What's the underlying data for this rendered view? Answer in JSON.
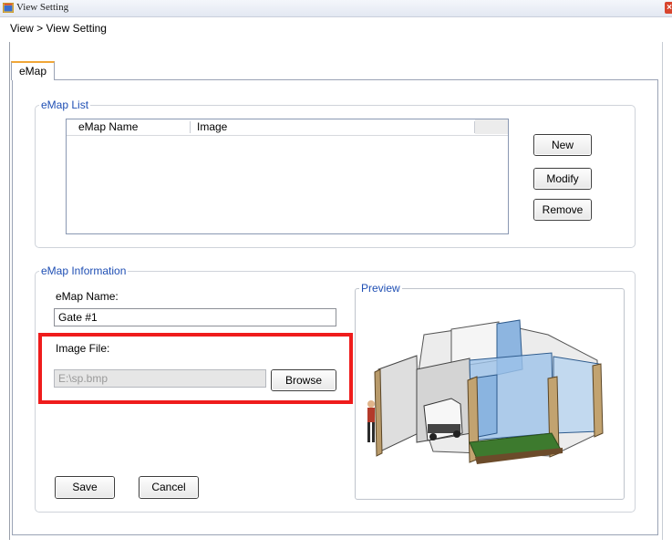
{
  "window": {
    "title": "View Setting",
    "close_glyph": "×"
  },
  "breadcrumb": "View > View Setting",
  "tabs": [
    {
      "label": "eMap",
      "active": true
    }
  ],
  "emap_list": {
    "legend": "eMap List",
    "columns": [
      "eMap Name",
      "Image"
    ],
    "rows": [],
    "buttons": {
      "new": "New",
      "modify": "Modify",
      "remove": "Remove"
    }
  },
  "emap_info": {
    "legend": "eMap Information",
    "name_label": "eMap Name:",
    "name_value": "Gate #1",
    "image_label": "Image File:",
    "image_value": "E:\\sp.bmp",
    "browse_label": "Browse",
    "save_label": "Save",
    "cancel_label": "Cancel",
    "preview_legend": "Preview"
  },
  "colors": {
    "accent_blue": "#1f4fb4",
    "highlight_red": "#ef1c1c",
    "tab_active": "#f0a637"
  },
  "icons": {
    "app": "app-window-icon",
    "close": "close-icon"
  }
}
